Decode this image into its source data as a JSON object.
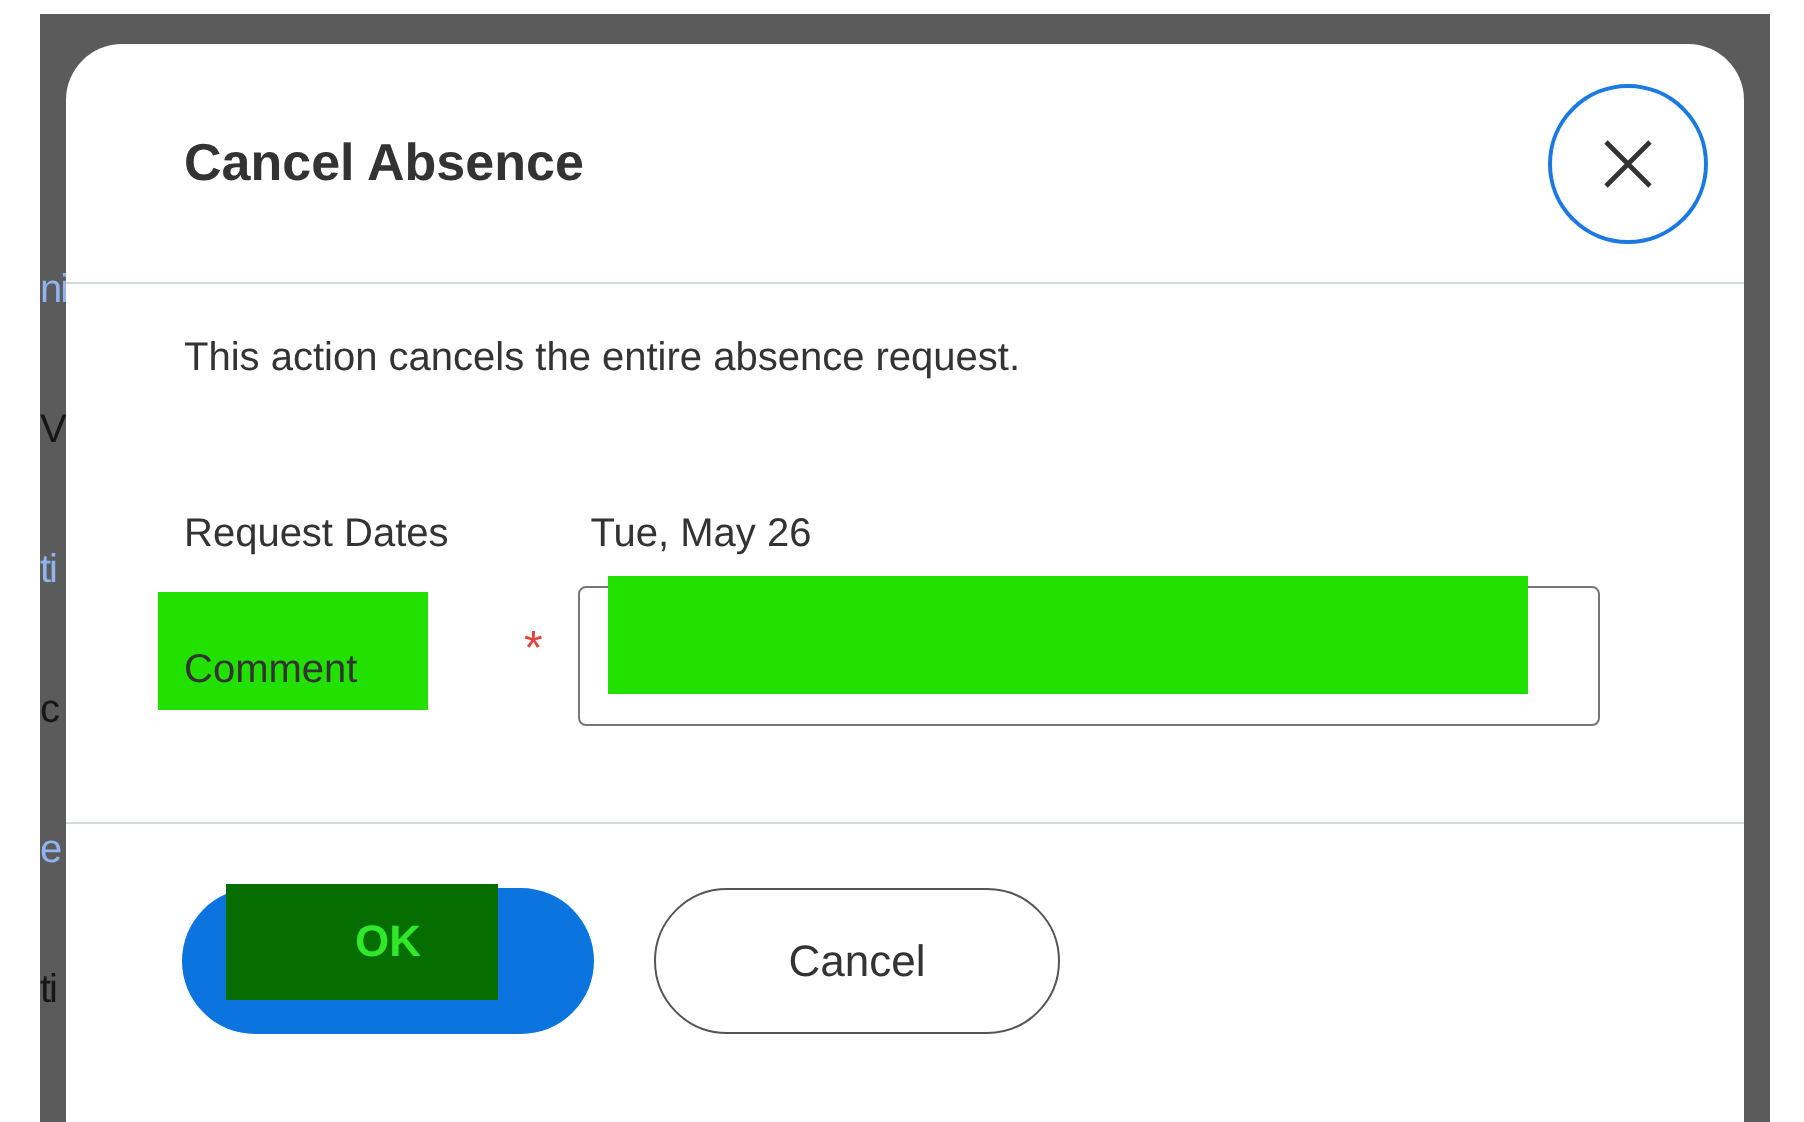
{
  "background_fragments": [
    {
      "text": "ni",
      "kind": "link"
    },
    {
      "text": "V",
      "kind": "text"
    },
    {
      "text": "ti",
      "kind": "link"
    },
    {
      "text": "c",
      "kind": "text"
    },
    {
      "text": "e",
      "kind": "link"
    },
    {
      "text": "ti",
      "kind": "text"
    }
  ],
  "dialog": {
    "title": "Cancel Absence",
    "message": "This action cancels the entire absence request.",
    "fields": [
      {
        "label": "Request Dates",
        "kind": "value",
        "value": "Tue, May 26"
      },
      {
        "label": "Comment",
        "kind": "input",
        "required": true,
        "required_mark": "*"
      }
    ],
    "buttons": [
      {
        "label": "OK",
        "kind": "primary"
      },
      {
        "label": "Cancel",
        "kind": "secondary"
      }
    ]
  }
}
